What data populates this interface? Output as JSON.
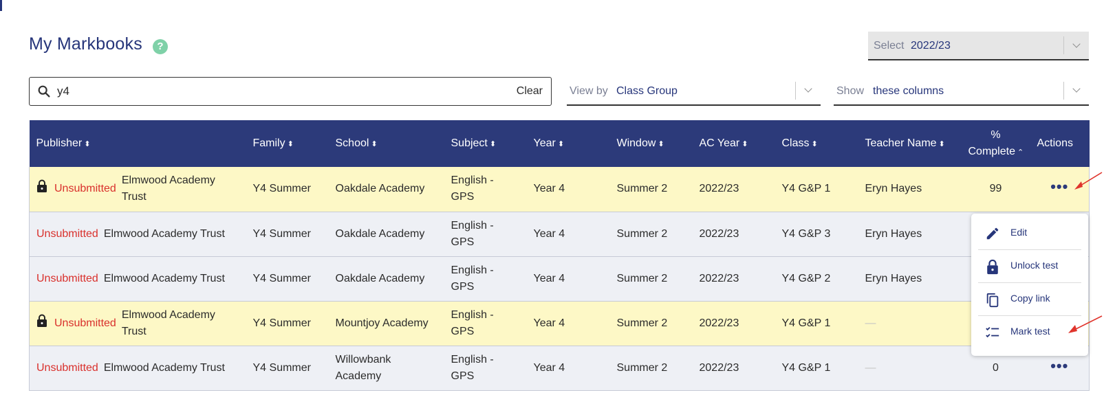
{
  "header": {
    "title": "My Markbooks",
    "help_icon": "help-circle-icon"
  },
  "year_select": {
    "label": "Select",
    "value": "2022/23"
  },
  "search": {
    "value": "y4",
    "clear_label": "Clear"
  },
  "view_by": {
    "label": "View by",
    "value": "Class Group"
  },
  "show_columns": {
    "label": "Show",
    "value": "these columns"
  },
  "table": {
    "columns": [
      {
        "label": "Publisher",
        "sort": "⬍"
      },
      {
        "label": "Family",
        "sort": "⬍"
      },
      {
        "label": "School",
        "sort": "⬍"
      },
      {
        "label": "Subject",
        "sort": "⬍"
      },
      {
        "label": "Year",
        "sort": "⬍"
      },
      {
        "label": "Window",
        "sort": "⬍"
      },
      {
        "label": "AC Year",
        "sort": "⬍"
      },
      {
        "label": "Class",
        "sort": "⬍"
      },
      {
        "label": "Teacher Name",
        "sort": "⬍"
      },
      {
        "label": "% Complete",
        "sort": "⌃"
      },
      {
        "label": "Actions",
        "sort": ""
      }
    ],
    "rows": [
      {
        "locked": true,
        "status": "Unsubmitted",
        "publisher": "Elmwood Academy Trust",
        "family": "Y4 Summer",
        "school": "Oakdale Academy",
        "subject": "English - GPS",
        "year": "Year 4",
        "window": "Summer 2",
        "ac_year": "2022/23",
        "class": "Y4 G&P 1",
        "teacher": "Eryn Hayes",
        "complete": "99",
        "actions": "•••"
      },
      {
        "locked": false,
        "status": "Unsubmitted",
        "publisher": "Elmwood Academy Trust",
        "family": "Y4 Summer",
        "school": "Oakdale Academy",
        "subject": "English - GPS",
        "year": "Year 4",
        "window": "Summer 2",
        "ac_year": "2022/23",
        "class": "Y4 G&P 3",
        "teacher": "Eryn Hayes",
        "complete": "",
        "actions": ""
      },
      {
        "locked": false,
        "status": "Unsubmitted",
        "publisher": "Elmwood Academy Trust",
        "family": "Y4 Summer",
        "school": "Oakdale Academy",
        "subject": "English - GPS",
        "year": "Year 4",
        "window": "Summer 2",
        "ac_year": "2022/23",
        "class": "Y4 G&P 2",
        "teacher": "Eryn Hayes",
        "complete": "",
        "actions": ""
      },
      {
        "locked": true,
        "status": "Unsubmitted",
        "publisher": "Elmwood Academy Trust",
        "family": "Y4 Summer",
        "school": "Mountjoy Academy",
        "subject": "English - GPS",
        "year": "Year 4",
        "window": "Summer 2",
        "ac_year": "2022/23",
        "class": "Y4 G&P 1",
        "teacher": "—",
        "complete": "",
        "actions": ""
      },
      {
        "locked": false,
        "status": "Unsubmitted",
        "publisher": "Elmwood Academy Trust",
        "family": "Y4 Summer",
        "school": "Willowbank Academy",
        "subject": "English - GPS",
        "year": "Year 4",
        "window": "Summer 2",
        "ac_year": "2022/23",
        "class": "Y4 G&P 1",
        "teacher": "—",
        "complete": "0",
        "actions": "•••"
      }
    ]
  },
  "actions_menu": {
    "items": [
      {
        "label": "Edit",
        "icon": "pencil-icon"
      },
      {
        "label": "Unlock test",
        "icon": "lock-icon"
      },
      {
        "label": "Copy link",
        "icon": "copy-icon"
      },
      {
        "label": "Mark test",
        "icon": "checklist-icon"
      }
    ]
  },
  "colors": {
    "header_bg": "#2c3a7a",
    "title": "#26357a",
    "status_red": "#d9302c",
    "locked_row_bg": "#fdf8c6",
    "row_bg": "#eef0f5",
    "annotation_arrow": "#e0342c"
  }
}
